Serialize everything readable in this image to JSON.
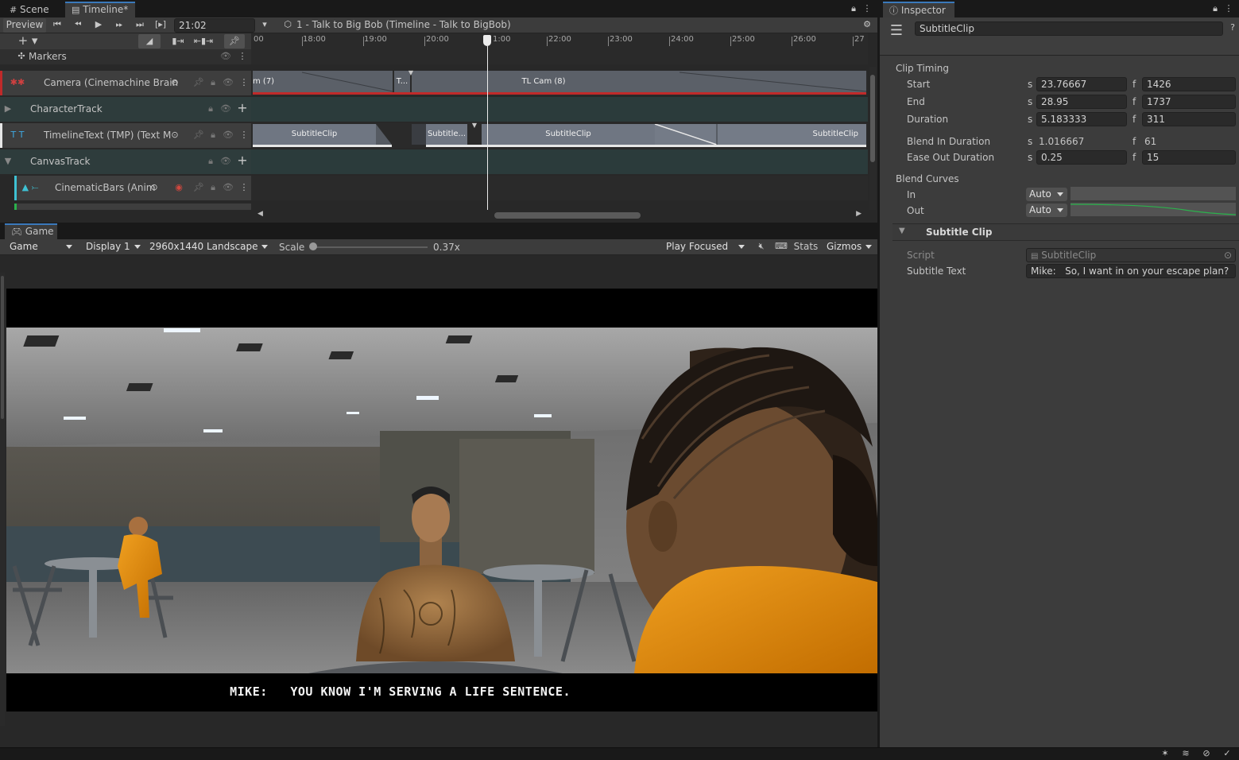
{
  "tabs": {
    "scene": "Scene",
    "timeline": "Timeline*",
    "inspector": "Inspector",
    "game": "Game"
  },
  "timeline": {
    "preview": "Preview",
    "current_time": "21:02",
    "asset_path": "1 - Talk to Big Bob (Timeline - Talk to BigBob)",
    "ruler": [
      "00",
      "18:00",
      "19:00",
      "20:00",
      "1:00",
      "22:00",
      "23:00",
      "24:00",
      "25:00",
      "26:00",
      "27"
    ],
    "markers_label": "Markers",
    "tracks": [
      {
        "label": "Camera (Cinemachine Brain",
        "color": "#c02a2a"
      },
      {
        "label": "CharacterTrack"
      },
      {
        "label": "TimelineText (TMP) (Text M",
        "color": "#e6e6e6"
      },
      {
        "label": "CanvasTrack"
      },
      {
        "label": "CinematicBars (Anim",
        "color": "#3ec1d3"
      }
    ],
    "camera_clips": [
      "m (7)",
      "T...",
      "TL Cam (8)"
    ],
    "subtitle_clips": [
      "SubtitleClip",
      "Subtitle...",
      "SubtitleClip",
      "SubtitleClip"
    ]
  },
  "game_toolbar": {
    "view": "Game",
    "display": "Display 1",
    "resolution": "2960x1440 Landscape",
    "scale_label": "Scale",
    "scale_value": "0.37x",
    "play_mode": "Play Focused",
    "stats": "Stats",
    "gizmos": "Gizmos"
  },
  "game_view": {
    "subtitle": "MIKE:   YOU KNOW I'M SERVING A LIFE SENTENCE."
  },
  "inspector": {
    "object_name": "SubtitleClip",
    "clip_timing_header": "Clip Timing",
    "rows": [
      {
        "label": "Start",
        "s": "23.76667",
        "f": "1426"
      },
      {
        "label": "End",
        "s": "28.95",
        "f": "1737"
      },
      {
        "label": "Duration",
        "s": "5.183333",
        "f": "311"
      }
    ],
    "blend_in": {
      "label": "Blend In Duration",
      "s": "1.016667",
      "f": "61"
    },
    "ease_out": {
      "label": "Ease Out Duration",
      "s": "0.25",
      "f": "15"
    },
    "s_unit": "s",
    "f_unit": "f",
    "blend_curves_header": "Blend Curves",
    "curve_in_label": "In",
    "curve_out_label": "Out",
    "curve_mode": "Auto",
    "subtitle_clip_header": "Subtitle Clip",
    "script_label": "Script",
    "script_value": "SubtitleClip",
    "subtitle_text_label": "Subtitle Text",
    "subtitle_text_value": "Mike:   So, I want in on your escape plan?"
  },
  "colors": {
    "accent": "#3a79bb",
    "camera_track": "#c02a2a",
    "canvas_track_icon": "#3ec1d3",
    "curve_green": "#2bb24c"
  }
}
